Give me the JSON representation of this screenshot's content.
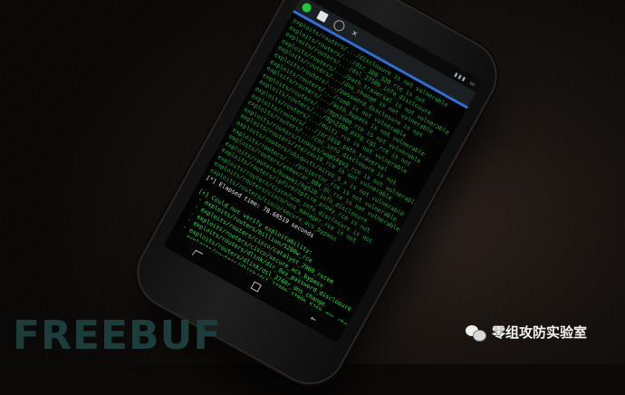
{
  "toolbar": {
    "icons": [
      "app-icon",
      "document-icon",
      "circle-icon",
      "close-icon"
    ],
    "close_glyph": "✕"
  },
  "terminal": {
    "lines": [
      {
        "t": "exploits/routers/.../disclosure is not vulnerable",
        "c": "dim"
      },
      {
        "t": "exploits/routers/.../dir_300_320_rce is not",
        "c": "dim"
      },
      {
        "t": "exploits/routers/.../dsl_2750b_info_disclosure",
        "c": "dim"
      },
      {
        "t": "exploits/routers/.../path_traversal is not vulnerable",
        "c": "dim"
      },
      {
        "t": "exploits/routers/.../dns_change is not vulnerable",
        "c": "dim"
      },
      {
        "t": "exploits/routers/.../password_disclosure is not",
        "c": "dim"
      },
      {
        "t": "exploits/routers/.../rom0 is not vulnerable",
        "c": "dim"
      },
      {
        "t": "exploits/routers/.../auth_bypass is not vulnerable",
        "c": "dim"
      },
      {
        "t": "exploits/routers/.../dgn1000_rce is not vulnerable",
        "c": "dim"
      },
      {
        "t": "exploits/routers/.../dgn2200_ping_cgi_rce is not",
        "c": "dim"
      },
      {
        "t": "exploits/routers/.../multi_rce is not vulnerable",
        "c": "dim"
      },
      {
        "t": "exploits/routers/.../jnr1010_path_traversal",
        "c": "dim"
      },
      {
        "t": "exploits/routers/.../cnr_info_disclosure is not",
        "c": "dim"
      },
      {
        "t": "exploits/routers/linksys/wap54gv3_rce is not vulnerable",
        "c": "dim"
      },
      {
        "t": "exploits/routers/zte/zxv10_rce is not vulnerable",
        "c": "dim"
      },
      {
        "t": "exploits/routers/ubiquiti/airos_6_x is not vulnerable",
        "c": "dim"
      },
      {
        "t": "exploits/routers/.../projector_rce is not vulnerable",
        "c": "dim"
      },
      {
        "t": "exploits/routers/asmax/ar_804_gu_rce is not vulnerable",
        "c": "dim"
      },
      {
        "t": "exploits/routers/huawei/hg520_info_disclosure",
        "c": "dim"
      },
      {
        "t": "exploits/routers/ipfire/ipfire_proxy_rce is not",
        "c": "dim"
      },
      {
        "t": "exploits/routers/cisco/ucm_info_disclosure is not",
        "c": "dim"
      },
      {
        "t": "exploits/routers/cisco/ucs_manager_rce is not",
        "c": "dim"
      },
      {
        "t": "exploits/routers/cisco/secure_acs_bypass",
        "c": "dim"
      },
      {
        "t": "[*] Elapsed time: 78.60519 seconds",
        "c": "white"
      },
      {
        "t": "",
        "c": "dim"
      },
      {
        "t": "[+] Could not verify exploitability:",
        "c": "green"
      },
      {
        "t": " - exploits/routers/billion/5200w_rce",
        "c": "green"
      },
      {
        "t": " - exploits/routers/cisco/catalyst_2960_rocem",
        "c": "green"
      },
      {
        "t": " - exploits/routers/cisco/secure_acs_bypass",
        "c": "green"
      },
      {
        "t": " - exploits/routers/dlink/dir_8xx_password_disclosure",
        "c": "green"
      },
      {
        "t": " - exploits/routers/dlink/dsl_2740r_dns_change",
        "c": "green"
      },
      {
        "t": " - exploits/routers/dlink/dsl_2730b_2780b_526b_dns_change",
        "c": "green"
      },
      {
        "t": " - exploits/routers/dlink/dsl_2640b_dns_change",
        "c": "green"
      },
      {
        "t": " - exploits/routers/netgear/n300_auth_bypass",
        "c": "green"
      },
      {
        "t": " - exploits/routers/shuttle/915wm_dns_change",
        "c": "green"
      },
      {
        "t": "",
        "c": "dim"
      },
      {
        "t": "[+] Device is vulnerable:",
        "c": "green"
      },
      {
        "t": " - exploits/cameras/dlink/dcs_930l_932l_auth_bypass",
        "c": "green"
      }
    ],
    "prompt_prefix": "rsf",
    "prompt_module": "AutoPwn",
    "prompt_suffix": " > "
  },
  "watermark": {
    "left": "FREEBUF",
    "right": "零组攻防实验室"
  },
  "colors": {
    "terminal_green": "#2fe04a",
    "prompt_red": "#ff3b3b",
    "accent_blue": "#2f6fd6"
  }
}
